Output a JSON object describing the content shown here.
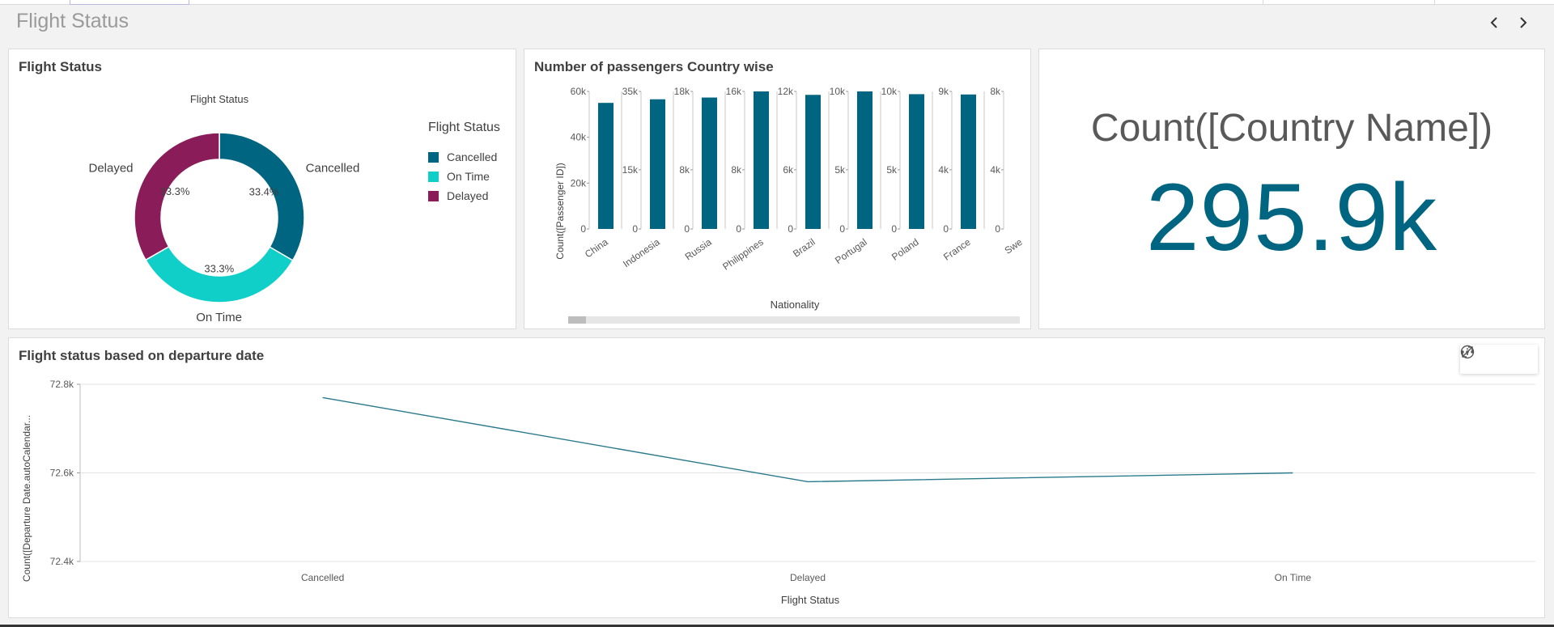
{
  "sheet": {
    "title": "Flight Status"
  },
  "donut": {
    "panel_title": "Flight Status",
    "chart_data": {
      "type": "pie",
      "title": "Flight Status",
      "legend_title": "Flight Status",
      "legend_position": "right",
      "slices": [
        {
          "label": "Cancelled",
          "value": 33.4,
          "display": "33.4%",
          "color": "#006580"
        },
        {
          "label": "On Time",
          "value": 33.3,
          "display": "33.3%",
          "color": "#10cfc9"
        },
        {
          "label": "Delayed",
          "value": 33.3,
          "display": "33.3%",
          "color": "#8a1c5a"
        }
      ]
    }
  },
  "bars": {
    "panel_title": "Number of passengers Country wise",
    "chart_data": {
      "type": "bar",
      "title": "Number of passengers Country wise",
      "xlabel": "Nationality",
      "ylabel": "Count([Passenger ID])",
      "color": "#006580",
      "mini_charts": [
        {
          "category": "China",
          "ylim": [
            0,
            60000
          ],
          "ticks": [
            "60k",
            "40k",
            "20k",
            "0"
          ],
          "value": 55000
        },
        {
          "category": "Indonesia",
          "ylim": [
            0,
            35000
          ],
          "ticks": [
            "35k",
            "15k",
            "0"
          ],
          "value": 33000
        },
        {
          "category": "Russia",
          "ylim": [
            0,
            18000
          ],
          "ticks": [
            "18k",
            "8k",
            "0"
          ],
          "value": 17200
        },
        {
          "category": "Philippines",
          "ylim": [
            0,
            16000
          ],
          "ticks": [
            "16k",
            "8k",
            "0"
          ],
          "value": 16000
        },
        {
          "category": "Brazil",
          "ylim": [
            0,
            12000
          ],
          "ticks": [
            "12k",
            "6k",
            "0"
          ],
          "value": 11700
        },
        {
          "category": "Portugal",
          "ylim": [
            0,
            10000
          ],
          "ticks": [
            "10k",
            "5k",
            "0"
          ],
          "value": 10000
        },
        {
          "category": "Poland",
          "ylim": [
            0,
            10000
          ],
          "ticks": [
            "10k",
            "5k",
            "0"
          ],
          "value": 9800
        },
        {
          "category": "France",
          "ylim": [
            0,
            9000
          ],
          "ticks": [
            "9k",
            "4k",
            "0"
          ],
          "value": 8800
        },
        {
          "category": "Swe",
          "ylim": [
            0,
            8000
          ],
          "ticks": [
            "8k",
            "4k",
            "0"
          ],
          "value": 0
        }
      ]
    }
  },
  "kpi": {
    "label": "Count([Country Name])",
    "value": "295.9k"
  },
  "line": {
    "panel_title": "Flight status based on departure date",
    "chart_data": {
      "type": "line",
      "title": "Flight status based on departure date",
      "xlabel": "Flight Status",
      "ylabel": "Count([Departure Date.autoCalendar...",
      "categories": [
        "Cancelled",
        "Delayed",
        "On Time"
      ],
      "values": [
        72770,
        72580,
        72600
      ],
      "ylim": [
        72400,
        72800
      ],
      "yticks": [
        "72.8k",
        "72.6k",
        "72.4k"
      ],
      "color": "#2a7a8c"
    },
    "toolbar": [
      "info-icon",
      "expand-icon",
      "more-icon"
    ]
  }
}
